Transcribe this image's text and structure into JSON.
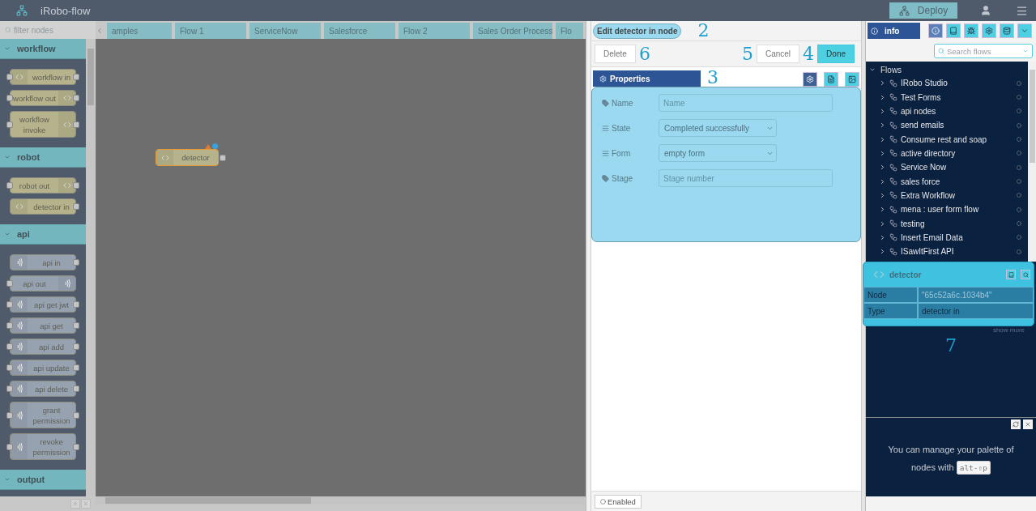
{
  "header": {
    "title": "iRobo-flow",
    "deploy": "Deploy"
  },
  "palette": {
    "filter_placeholder": "filter nodes",
    "categories": [
      {
        "name": "workflow",
        "expanded": true,
        "nodes": [
          {
            "label": "workflow in",
            "kind": "input",
            "in_port": true,
            "out_port": true,
            "color": "#b5b28c"
          },
          {
            "label": "workflow out",
            "kind": "output",
            "in_port": true,
            "out_port": true,
            "color": "#b5b28c"
          },
          {
            "label": "workflow invoke",
            "kind": "output",
            "in_port": true,
            "out_port": true,
            "color": "#b5b28c"
          }
        ]
      },
      {
        "name": "robot",
        "expanded": true,
        "nodes": [
          {
            "label": "robot out",
            "kind": "output",
            "in_port": true,
            "out_port": true,
            "color": "#b5b28c"
          },
          {
            "label": "detector in",
            "kind": "input",
            "in_port": false,
            "out_port": true,
            "color": "#b5b28c"
          }
        ]
      },
      {
        "name": "api",
        "expanded": true,
        "nodes": [
          {
            "label": "api in",
            "kind": "input",
            "in_port": false,
            "out_port": true,
            "color": "#97a2b0"
          },
          {
            "label": "api out",
            "kind": "output",
            "in_port": true,
            "out_port": false,
            "color": "#97a2b0"
          },
          {
            "label": "api get jwt",
            "kind": "input",
            "in_port": true,
            "out_port": true,
            "color": "#97a2b0"
          },
          {
            "label": "api get",
            "kind": "input",
            "in_port": true,
            "out_port": true,
            "color": "#97a2b0"
          },
          {
            "label": "api add",
            "kind": "input",
            "in_port": true,
            "out_port": true,
            "color": "#97a2b0"
          },
          {
            "label": "api update",
            "kind": "input",
            "in_port": true,
            "out_port": true,
            "color": "#97a2b0"
          },
          {
            "label": "api delete",
            "kind": "input",
            "in_port": true,
            "out_port": true,
            "color": "#97a2b0"
          },
          {
            "label": "grant permission",
            "kind": "input",
            "in_port": true,
            "out_port": true,
            "color": "#97a2b0"
          },
          {
            "label": "revoke permission",
            "kind": "input",
            "in_port": true,
            "out_port": true,
            "color": "#97a2b0"
          }
        ]
      },
      {
        "name": "output",
        "expanded": true
      }
    ]
  },
  "workspace": {
    "tabs": [
      {
        "label": "amples",
        "selected": false
      },
      {
        "label": "Flow 1",
        "selected": false
      },
      {
        "label": "ServiceNow",
        "selected": false
      },
      {
        "label": "Salesforce",
        "selected": false
      },
      {
        "label": "Flow 2",
        "selected": false
      },
      {
        "label": "Sales Order Process",
        "selected": false
      },
      {
        "label": "Flo",
        "selected": false
      }
    ],
    "node": {
      "label": "detector",
      "selected": true,
      "changed": true
    }
  },
  "editor": {
    "title": "Edit detector in node",
    "title_mark": "2",
    "delete": "Delete",
    "delete_mark": "6",
    "cancel_mark": "5",
    "cancel": "Cancel",
    "done_mark": "4",
    "done": "Done",
    "tab": "Properties",
    "tab_mark": "3",
    "fields": [
      {
        "label": "Name",
        "kind": "text",
        "placeholder": "Name"
      },
      {
        "label": "State",
        "kind": "select",
        "value": "Completed successfully"
      },
      {
        "label": "Form",
        "kind": "select",
        "value": "empty form"
      },
      {
        "label": "Stage",
        "kind": "text",
        "placeholder": "Stage number"
      }
    ],
    "enabled": "Enabled"
  },
  "sidebar": {
    "tab": "info",
    "search_placeholder": "Search flows",
    "tree_label": "Flows",
    "expanded": true,
    "flows": [
      "IRobo Studio",
      "Test Forms",
      "api nodes",
      "send emails",
      "Consume rest and soap",
      "active directory",
      "Service Now",
      "sales force",
      "Extra Workflow",
      "mena : user form flow",
      "testing",
      "Insert Email Data",
      "ISawItFirst API"
    ],
    "info": {
      "title": "detector",
      "rows": [
        {
          "key": "Node",
          "value": "\"65c52a6c.1034b4\""
        },
        {
          "key": "Type",
          "value": "detector in"
        }
      ],
      "show_more": "show more"
    },
    "info_mark": "7",
    "help": {
      "text": "You can manage your palette of nodes with",
      "key": "alt-⇧p"
    }
  }
}
